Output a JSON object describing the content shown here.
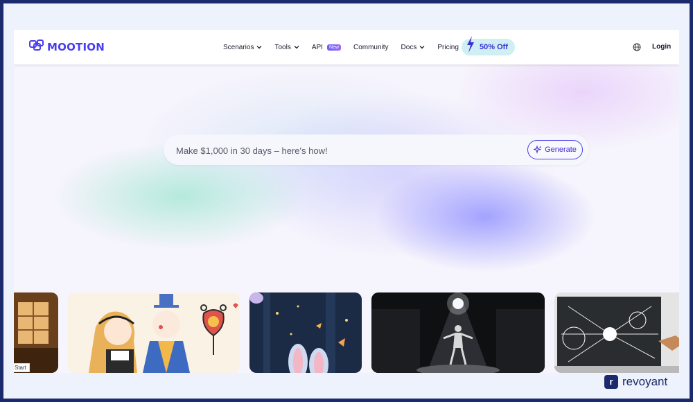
{
  "brand": {
    "name": "MOOTION",
    "color": "#4a3df0",
    "icon": "mootion-logo-icon"
  },
  "nav": {
    "items": [
      {
        "label": "Scenarios",
        "dropdown": true
      },
      {
        "label": "Tools",
        "dropdown": true
      },
      {
        "label": "API",
        "badge": "New"
      },
      {
        "label": "Community"
      },
      {
        "label": "Docs",
        "dropdown": true
      },
      {
        "label": "Pricing"
      }
    ],
    "promo": "50% Off",
    "login": "Login"
  },
  "hero": {
    "prompt_placeholder": "Make $1,000 in 30 days – here's how!",
    "generate_label": "Generate"
  },
  "gallery": {
    "first_card_chip": "Start",
    "cards": [
      {
        "subject": "warm-lit interior"
      },
      {
        "subject": "anime girl and boy with heart clock"
      },
      {
        "subject": "bunny ears in glowing forest with butterflies"
      },
      {
        "subject": "dancer under spotlight on dark stage"
      },
      {
        "subject": "chalkboard with formulas and light burst"
      }
    ]
  },
  "watermark": {
    "mark": "r",
    "text": "revoyant"
  }
}
